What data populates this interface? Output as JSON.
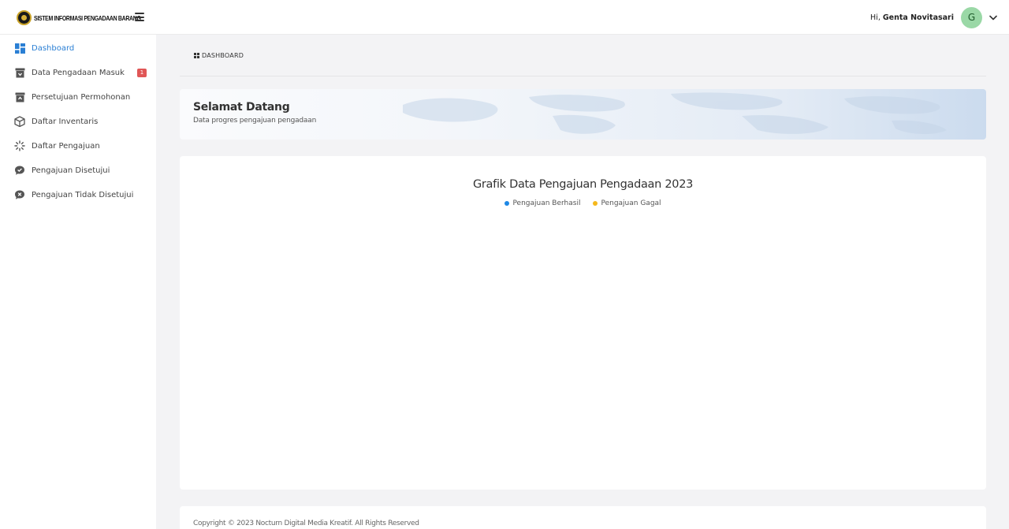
{
  "app": {
    "title": "SISTEM INFORMASI PENGADAAN BARANG",
    "logo_icon": "emblem-logo-icon",
    "menu_icon": "hamburger-icon"
  },
  "user": {
    "greeting": "Hi,",
    "name": "Genta Novitasari",
    "avatar_initial": "G",
    "avatar_color": "#9ad8a6",
    "dropdown_icon": "chevron-down-icon"
  },
  "sidebar": {
    "items": [
      {
        "label": "Dashboard",
        "icon": "dashboard-grid-icon",
        "active": true
      },
      {
        "label": "Data Pengadaan Masuk",
        "icon": "inbox-box-icon",
        "badge": "1"
      },
      {
        "label": "Persetujuan Permohonan",
        "icon": "approval-box-icon"
      },
      {
        "label": "Daftar Inventaris",
        "icon": "package-cube-icon"
      },
      {
        "label": "Daftar Pengajuan",
        "icon": "spinner-icon"
      },
      {
        "label": "Pengajuan Disetujui",
        "icon": "chat-check-icon"
      },
      {
        "label": "Pengajuan Tidak Disetujui",
        "icon": "chat-x-icon"
      }
    ]
  },
  "breadcrumb": {
    "icon": "dashboard-small-icon",
    "label": "DASHBOARD"
  },
  "welcome": {
    "title": "Selamat Datang",
    "subtitle": "Data progres pengajuan pengadaan"
  },
  "chart_data": {
    "type": "bar",
    "title": "Grafik Data Pengajuan Pengadaan 2023",
    "series": [
      {
        "name": "Pengajuan Berhasil",
        "color": "#1e88e5",
        "values": []
      },
      {
        "name": "Pengajuan Gagal",
        "color": "#f5b81c",
        "values": []
      }
    ],
    "legend": "top-center"
  },
  "footer": {
    "text": "Copyright © 2023 Nocturn Digital Media Kreatif. All Rights Reserved"
  },
  "colors": {
    "accent": "#2a7fd4",
    "badge": "#e05656"
  }
}
